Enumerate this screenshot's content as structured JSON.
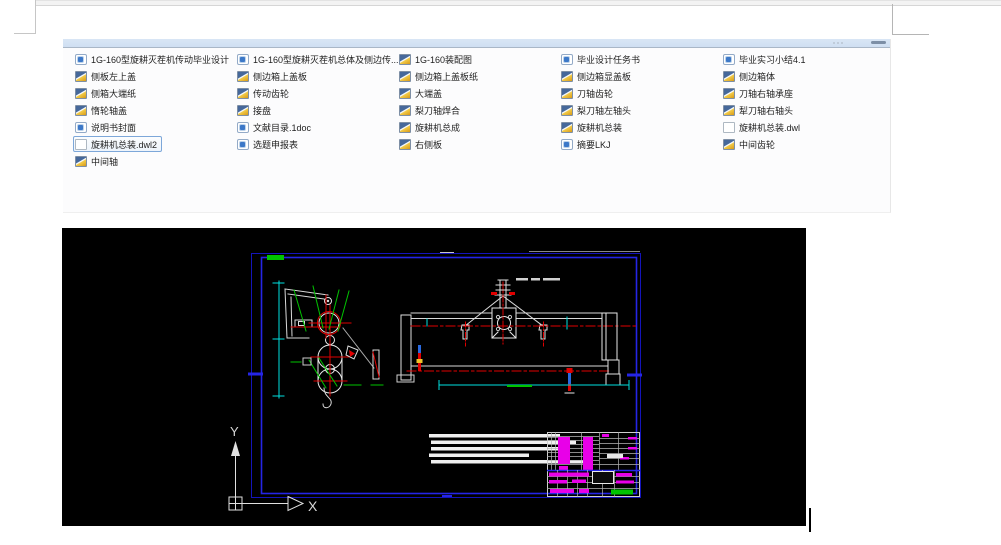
{
  "file_panel": {
    "columns": [
      {
        "items": [
          {
            "icon": "doc",
            "label": "1G-160型旋耕灭茬机传动毕业设计"
          },
          {
            "icon": "img",
            "label": "侧板左上盖"
          },
          {
            "icon": "img",
            "label": "侧箱大端纸"
          },
          {
            "icon": "img",
            "label": "惰轮轴盖"
          },
          {
            "icon": "doc",
            "label": "说明书封面"
          },
          {
            "icon": "blank",
            "label": "旋耕机总装.dwl2",
            "selected": true
          },
          {
            "icon": "img",
            "label": "中间轴"
          }
        ]
      },
      {
        "items": [
          {
            "icon": "doc",
            "label": "1G-160型旋耕灭茬机总体及侧边传..."
          },
          {
            "icon": "img",
            "label": "侧边箱上盖板"
          },
          {
            "icon": "img",
            "label": "传动齿轮"
          },
          {
            "icon": "img",
            "label": "接盘"
          },
          {
            "icon": "doc",
            "label": "文献目录.1doc"
          },
          {
            "icon": "doc",
            "label": "选题申报表"
          }
        ]
      },
      {
        "items": [
          {
            "icon": "img",
            "label": "1G-160装配图"
          },
          {
            "icon": "img",
            "label": "侧边箱上盖板纸"
          },
          {
            "icon": "img",
            "label": "大端盖"
          },
          {
            "icon": "img",
            "label": "梨刀轴焊合"
          },
          {
            "icon": "img",
            "label": "旋耕机总成"
          },
          {
            "icon": "img",
            "label": "右侧板"
          }
        ]
      },
      {
        "items": [
          {
            "icon": "doc",
            "label": "毕业设计任务书"
          },
          {
            "icon": "img",
            "label": "侧边箱显盖板"
          },
          {
            "icon": "img",
            "label": "刀轴齿轮"
          },
          {
            "icon": "img",
            "label": "梨刀轴左轴头"
          },
          {
            "icon": "img",
            "label": "旋耕机总装"
          },
          {
            "icon": "doc",
            "label": "摘要LKJ"
          }
        ]
      },
      {
        "items": [
          {
            "icon": "doc",
            "label": "毕业实习小结4.1"
          },
          {
            "icon": "img",
            "label": "侧边箱体"
          },
          {
            "icon": "img",
            "label": "刀轴右轴承座"
          },
          {
            "icon": "img",
            "label": "犁刀轴右轴头"
          },
          {
            "icon": "blank",
            "label": "旋耕机总装.dwl"
          },
          {
            "icon": "img",
            "label": "中间齿轮"
          }
        ]
      }
    ]
  },
  "cad": {
    "ucs": {
      "x_label": "X",
      "y_label": "Y"
    }
  },
  "colors": {
    "frame-blue": "#2525e6",
    "cad-cyan": "#00e0e0",
    "cad-red": "#e00000",
    "cad-green": "#00c400",
    "cad-magenta": "#e800e8",
    "panel-header": "#d9e6f5",
    "selection-border": "#7da7d9"
  }
}
